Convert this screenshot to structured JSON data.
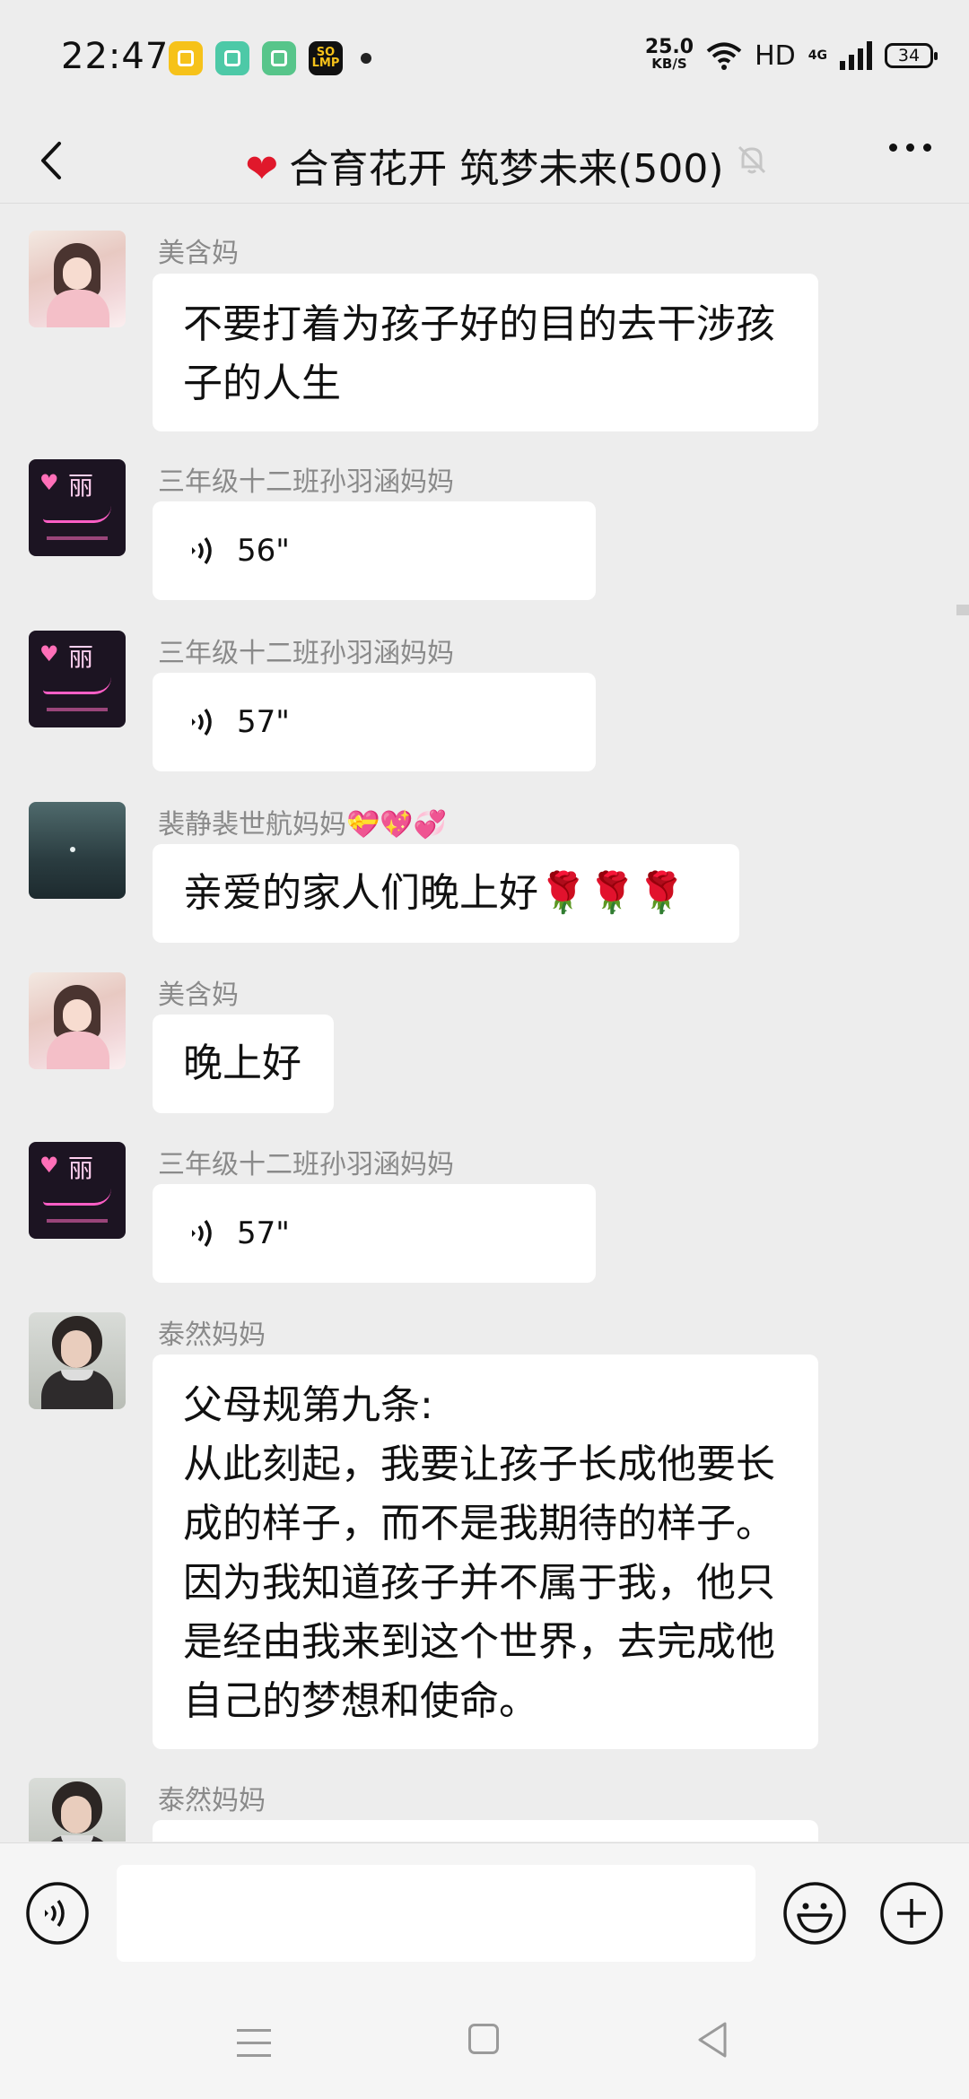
{
  "status_bar": {
    "time": "22:47",
    "app_icons": [
      "notes-app-icon",
      "gallery-app-icon",
      "calculator-app-icon",
      "soul-app-icon"
    ],
    "soul_badge": "SO\nLMP",
    "net_speed_value": "25.0",
    "net_speed_unit": "KB/S",
    "hd": "HD",
    "network": "4G",
    "battery": "34"
  },
  "header": {
    "title": "合育花开 筑梦未来(500)",
    "title_emoji": "❤",
    "muted": true
  },
  "messages": [
    {
      "sender": "美含妈",
      "type": "text",
      "text": "不要打着为孩子好的目的去干涉孩子的人生",
      "avatar": "girl-avatar"
    },
    {
      "sender": "三年级十二班孙羽涵妈妈",
      "type": "voice",
      "duration": "56\"",
      "avatar": "neon-avatar"
    },
    {
      "sender": "三年级十二班孙羽涵妈妈",
      "type": "voice",
      "duration": "57\"",
      "avatar": "neon-avatar"
    },
    {
      "sender": "裴静裴世航妈妈💝💖💞",
      "type": "text",
      "text": "亲爱的家人们晚上好🌹🌹🌹",
      "avatar": "night-avatar"
    },
    {
      "sender": "美含妈",
      "type": "text",
      "text": "晚上好",
      "avatar": "girl-avatar"
    },
    {
      "sender": "三年级十二班孙羽涵妈妈",
      "type": "voice",
      "duration": "57\"",
      "avatar": "neon-avatar"
    },
    {
      "sender": "泰然妈妈",
      "type": "text",
      "text": "父母规第九条:\n从此刻起，我要让孩子长成他要长成的样子，而不是我期待的样子。因为我知道孩子并不属于我，他只是经由我来到这个世界，去完成他自己的梦想和使命。",
      "avatar": "woman-avatar"
    },
    {
      "sender": "泰然妈妈",
      "type": "text",
      "text": "",
      "avatar": "woman-avatar"
    }
  ],
  "input_bar": {
    "voice_button": "voice-input-icon",
    "emoji_button": "emoji-icon",
    "more_button": "plus-icon",
    "text": ""
  },
  "nav_bar": {
    "items": [
      "menu-icon",
      "home-icon",
      "back-icon"
    ]
  }
}
